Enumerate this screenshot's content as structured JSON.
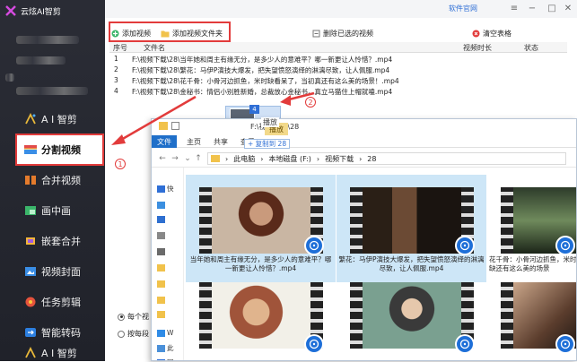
{
  "app": {
    "title": "云炫AI智剪"
  },
  "sidebar": {
    "items": [
      {
        "label": "A I 智剪",
        "icon": "ai-icon"
      },
      {
        "label": "分割视频",
        "icon": "split-video-icon",
        "active": true
      },
      {
        "label": "合并视频",
        "icon": "merge-video-icon"
      },
      {
        "label": "画中画",
        "icon": "picture-in-picture-icon"
      },
      {
        "label": "嵌套合并",
        "icon": "nested-merge-icon"
      },
      {
        "label": "视频封面",
        "icon": "video-cover-icon"
      },
      {
        "label": "任务剪辑",
        "icon": "task-edit-icon"
      },
      {
        "label": "智能转码",
        "icon": "smart-transcode-icon"
      },
      {
        "label": "A I 智剪",
        "icon": "ai-icon"
      }
    ]
  },
  "topbar": {
    "official_site": "软件官网"
  },
  "toolbar": {
    "add_video": "添加视频",
    "add_folder": "添加视频文件夹",
    "delete_selected": "删除已选的视频",
    "clear_table": "清空表格"
  },
  "table": {
    "headers": [
      "序号",
      "文件名",
      "视频时长",
      "状态"
    ],
    "rows": [
      {
        "num": "1",
        "name": "F:\\视频下载\\28\\当年她和周主有缘无分，是多少人的意难平？哪一新更让人怜惜？.mp4"
      },
      {
        "num": "2",
        "name": "F:\\视频下载\\28\\繁花：马伊P演技大爆发，把失望愤怒演绎的淋漓尽致，让人佩服.mp4"
      },
      {
        "num": "3",
        "name": "F:\\视频下载\\28\\花千骨：小骨河边抓鱼，米时缺看呆了，当初真还有这么美的场景！.mp4"
      },
      {
        "num": "4",
        "name": "F:\\视频下载\\28\\金秘书：情侣小别胜新婚，总裁放心金秘书，真立马猫住上帽就嗑.mp4"
      }
    ]
  },
  "options": {
    "opt1": "每个视",
    "opt2": "按每段"
  },
  "drag": {
    "badge": "4",
    "ghost_text": "播放",
    "copy_tip": "+ 复制到 28"
  },
  "explorer": {
    "title": "F:\\视频下载\\28",
    "tabs": [
      "文件",
      "主页",
      "共享",
      "查看",
      "播放"
    ],
    "breadcrumb": [
      "此电脑",
      "本地磁盘 (F:)",
      "视频下载",
      "28"
    ],
    "nav_left": [
      "快",
      "W",
      "此",
      "网"
    ],
    "files": [
      {
        "caption": "当年她和周主有缘无分，是多少人的意难平？哪一新更让人怜惜？.mp4"
      },
      {
        "caption": "繁花：马伊P演技大爆发，把失望愤怒演绎的淋漓尽致，让人佩服.mp4"
      },
      {
        "caption": "花千骨：小骨河边抓鱼，米时缺还有这么美的场景"
      },
      {
        "caption": ""
      },
      {
        "caption": ""
      },
      {
        "caption": ""
      }
    ]
  },
  "annotations": {
    "step1": "1",
    "step2": "2"
  },
  "colors": {
    "accent_red": "#e23b3b",
    "explorer_blue": "#1f6fc9",
    "sidebar_bg": "#2b2d36"
  }
}
